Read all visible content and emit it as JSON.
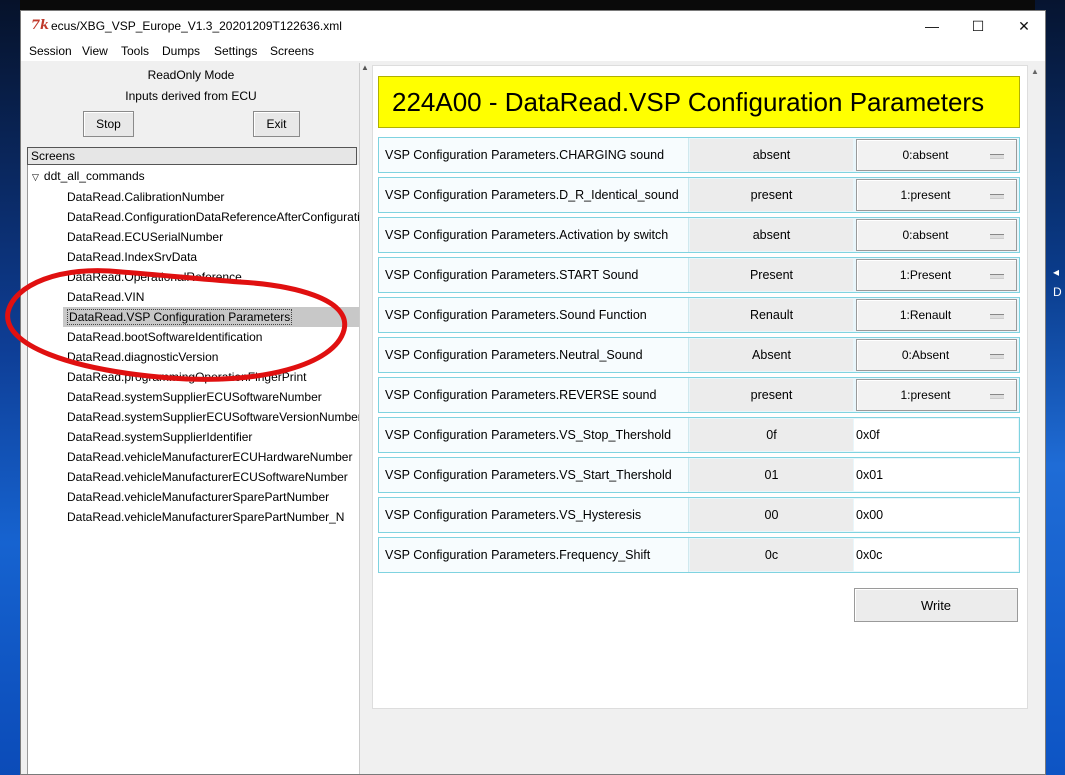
{
  "window": {
    "title": "ecus/XBG_VSP_Europe_V1.3_20201209T122636.xml",
    "logo_text": "7k",
    "controls": [
      "—",
      "☐",
      "✕"
    ]
  },
  "menu": [
    "Session",
    "View",
    "Tools",
    "Dumps",
    "Settings",
    "Screens"
  ],
  "left": {
    "mode_line1": "ReadOnly Mode",
    "mode_line2": "Inputs derived from ECU",
    "stop_label": "Stop",
    "exit_label": "Exit",
    "screens_header": "Screens",
    "tree_root": "ddt_all_commands",
    "tree_items": [
      "DataRead.CalibrationNumber",
      "DataRead.ConfigurationDataReferenceAfterConfiguration",
      "DataRead.ECUSerialNumber",
      "DataRead.IndexSrvData",
      "DataRead.OperationalReference",
      "DataRead.VIN",
      "DataRead.VSP Configuration Parameters",
      "DataRead.bootSoftwareIdentification",
      "DataRead.diagnosticVersion",
      "DataRead.programmingOperationFingerPrint",
      "DataRead.systemSupplierECUSoftwareNumber",
      "DataRead.systemSupplierECUSoftwareVersionNumber",
      "DataRead.systemSupplierIdentifier",
      "DataRead.vehicleManufacturerECUHardwareNumber",
      "DataRead.vehicleManufacturerECUSoftwareNumber",
      "DataRead.vehicleManufacturerSparePartNumber",
      "DataRead.vehicleManufacturerSparePartNumber_N"
    ],
    "selected_index": 6
  },
  "main": {
    "header": "224A00 - DataRead.VSP Configuration Parameters",
    "rows": [
      {
        "label": "VSP Configuration Parameters.CHARGING sound",
        "value": "absent",
        "select": "0:absent"
      },
      {
        "label": "VSP Configuration Parameters.D_R_Identical_sound",
        "value": "present",
        "select": "1:present"
      },
      {
        "label": "VSP Configuration Parameters.Activation by switch",
        "value": "absent",
        "select": "0:absent"
      },
      {
        "label": "VSP Configuration Parameters.START Sound",
        "value": "Present",
        "select": "1:Present"
      },
      {
        "label": "VSP Configuration Parameters.Sound Function",
        "value": "Renault",
        "select": "1:Renault"
      },
      {
        "label": "VSP Configuration Parameters.Neutral_Sound",
        "value": "Absent",
        "select": "0:Absent"
      },
      {
        "label": "VSP Configuration Parameters.REVERSE sound",
        "value": "present",
        "select": "1:present"
      },
      {
        "label": "VSP Configuration Parameters.VS_Stop_Thershold",
        "value": "0f",
        "input": "0x0f"
      },
      {
        "label": "VSP Configuration Parameters.VS_Start_Thershold",
        "value": "01",
        "input": "0x01"
      },
      {
        "label": "VSP Configuration Parameters.VS_Hysteresis",
        "value": "00",
        "input": "0x00"
      },
      {
        "label": "VSP Configuration Parameters.Frequency_Shift",
        "value": "0c",
        "input": "0x0c"
      }
    ],
    "write_label": "Write"
  },
  "desktop": {
    "edge_letter": "D"
  },
  "colors": {
    "header_bg": "#ffff00",
    "row_border": "#7fd3e0",
    "annotation": "#e01010"
  }
}
